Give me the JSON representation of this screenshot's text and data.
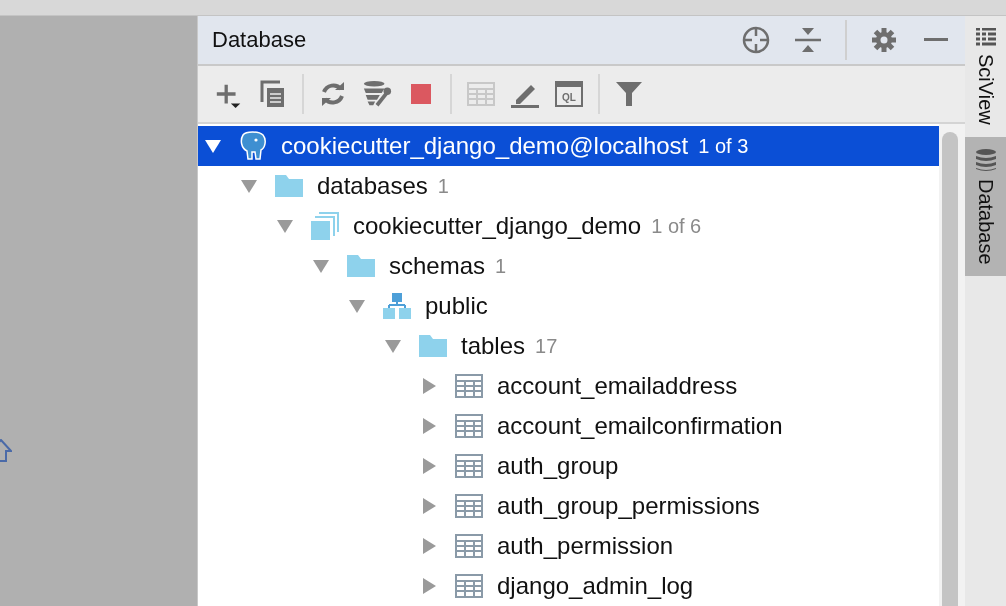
{
  "panel": {
    "title": "Database"
  },
  "header_tools": [
    {
      "kind": "locate"
    },
    {
      "kind": "collapse"
    },
    {
      "kind": "divider"
    },
    {
      "kind": "settings"
    },
    {
      "kind": "minimize"
    }
  ],
  "toolbar": [
    {
      "kind": "add",
      "disabled": false
    },
    {
      "kind": "duplicate",
      "disabled": false
    },
    {
      "kind": "divider"
    },
    {
      "kind": "refresh",
      "disabled": false
    },
    {
      "kind": "properties",
      "disabled": false
    },
    {
      "kind": "stop",
      "disabled": false
    },
    {
      "kind": "divider"
    },
    {
      "kind": "table",
      "disabled": true
    },
    {
      "kind": "edit",
      "disabled": false
    },
    {
      "kind": "console",
      "disabled": false
    },
    {
      "kind": "divider"
    },
    {
      "kind": "filter",
      "disabled": false
    }
  ],
  "console_label": "QL",
  "tree": [
    {
      "kind": "connection",
      "label": "cookiecutter_django_demo@localhost",
      "count": "1 of 3",
      "expanded": true,
      "selected": true,
      "children": [
        {
          "kind": "folder",
          "label": "databases",
          "count": "1",
          "expanded": true,
          "selected": false,
          "children": [
            {
              "kind": "database",
              "label": "cookiecutter_django_demo",
              "count": "1 of 6",
              "expanded": true,
              "selected": false,
              "children": [
                {
                  "kind": "folder",
                  "label": "schemas",
                  "count": "1",
                  "expanded": true,
                  "selected": false,
                  "children": [
                    {
                      "kind": "schema",
                      "label": "public",
                      "expanded": true,
                      "selected": false,
                      "children": [
                        {
                          "kind": "folder",
                          "label": "tables",
                          "count": "17",
                          "expanded": true,
                          "selected": false,
                          "children": [
                            {
                              "kind": "table",
                              "label": "account_emailaddress",
                              "expanded": false,
                              "selected": false
                            },
                            {
                              "kind": "table",
                              "label": "account_emailconfirmation",
                              "expanded": false,
                              "selected": false
                            },
                            {
                              "kind": "table",
                              "label": "auth_group",
                              "expanded": false,
                              "selected": false
                            },
                            {
                              "kind": "table",
                              "label": "auth_group_permissions",
                              "expanded": false,
                              "selected": false
                            },
                            {
                              "kind": "table",
                              "label": "auth_permission",
                              "expanded": false,
                              "selected": false
                            },
                            {
                              "kind": "table",
                              "label": "django_admin_log",
                              "expanded": false,
                              "selected": false
                            }
                          ]
                        }
                      ]
                    }
                  ]
                }
              ]
            }
          ]
        }
      ]
    }
  ],
  "side_tabs": [
    {
      "kind": "sciview",
      "label": "SciView",
      "selected": false
    },
    {
      "kind": "database",
      "label": "Database",
      "selected": true
    }
  ]
}
